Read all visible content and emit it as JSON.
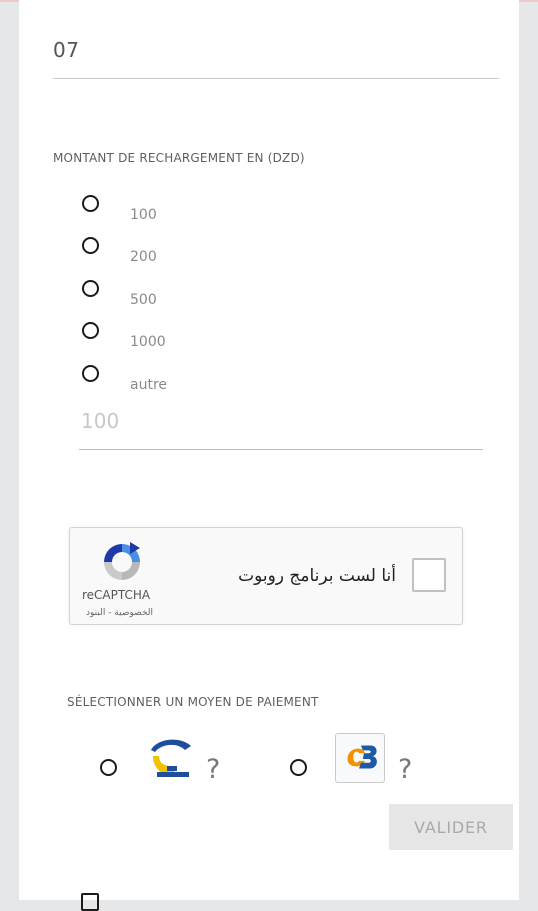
{
  "phone": {
    "value": "07"
  },
  "amount_section": {
    "label": "MONTANT DE RECHARGEMENT EN (DZD)",
    "options": [
      "100",
      "200",
      "500",
      "1000",
      "autre"
    ],
    "custom_amount_placeholder": "100"
  },
  "recaptcha": {
    "checkbox_text": "أنا لست برنامج روبوت",
    "brand": "reCAPTCHA",
    "links": "الخصوصية - البنود"
  },
  "payment": {
    "label": "SÉLECTIONNER UN MOYEN DE PAIEMENT",
    "methods": [
      {
        "icon": "edahabia-card-icon",
        "help": "?"
      },
      {
        "icon": "cib-logo-icon",
        "help": "?"
      }
    ]
  },
  "submit": {
    "label": "VALIDER"
  }
}
